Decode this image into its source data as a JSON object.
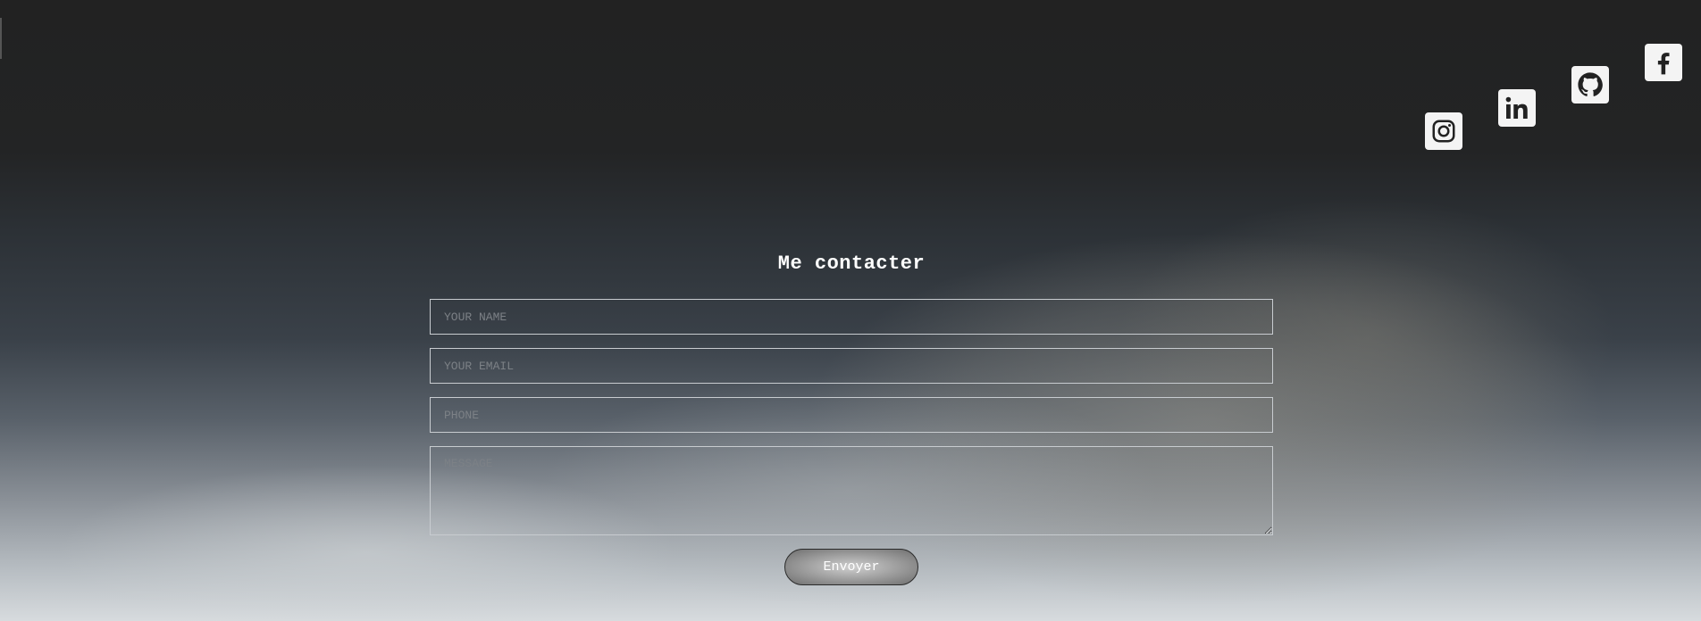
{
  "social": [
    {
      "name": "instagram",
      "icon": "instagram-icon"
    },
    {
      "name": "linkedin",
      "icon": "linkedin-icon"
    },
    {
      "name": "github",
      "icon": "github-icon"
    },
    {
      "name": "facebook",
      "icon": "facebook-icon"
    }
  ],
  "contact": {
    "title": "Me contacter",
    "name_placeholder": "YOUR NAME",
    "email_placeholder": "YOUR EMAIL",
    "phone_placeholder": "PHONE",
    "message_placeholder": "MESSAGE",
    "submit_label": "Envoyer"
  },
  "colors": {
    "header_bg": "#222222",
    "field_border": "#c8ccd0",
    "icon_bg": "#f4f4f4",
    "icon_fg": "#222222"
  }
}
